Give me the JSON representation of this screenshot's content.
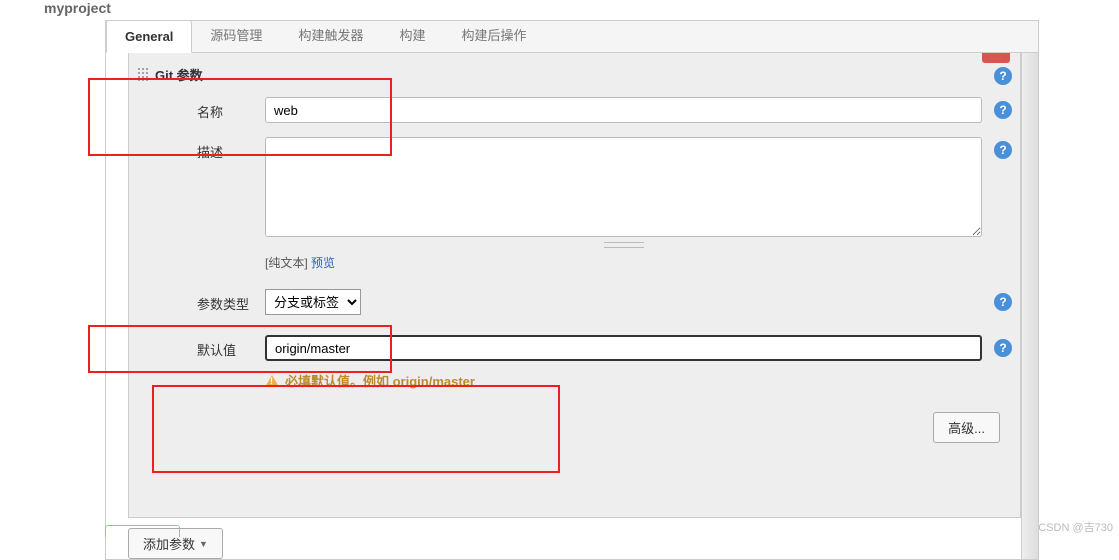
{
  "project_title": "myproject",
  "tabs": {
    "general": "General",
    "scm": "源码管理",
    "triggers": "构建触发器",
    "build": "构建",
    "postbuild": "构建后操作"
  },
  "section": {
    "title": "Git 参数"
  },
  "fields": {
    "name_label": "名称",
    "name_value": "web",
    "desc_label": "描述",
    "desc_value": "",
    "plaintext_prefix": "[纯文本] ",
    "preview_link": "预览",
    "param_type_label": "参数类型",
    "param_type_value": "分支或标签",
    "default_label": "默认值",
    "default_value": "origin/master",
    "default_warning": "必填默认值。例如 origin/master"
  },
  "buttons": {
    "advanced": "高级...",
    "add_param": "添加参数"
  },
  "watermark": "CSDN @吉730"
}
